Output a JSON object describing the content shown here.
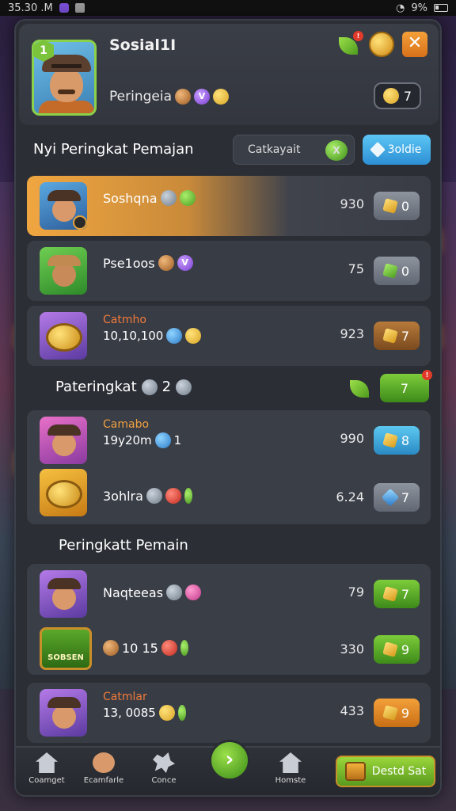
{
  "status_bar": {
    "time": "35.30 .M",
    "battery": "9%"
  },
  "profile": {
    "level": "1",
    "name": "Sosial1I",
    "subtitle": "Peringeia",
    "currency_value": "7"
  },
  "ranking": {
    "header": "Nyi Peringkat Pemajan",
    "category_label": "Catkayait",
    "category_icon_text": "X",
    "sort_label": "3oldie"
  },
  "rows_top": [
    {
      "name": "Soshqna",
      "score": "930",
      "btn_value": "0",
      "style": "highlight"
    },
    {
      "name": "Pse1oos",
      "score": "75",
      "btn_value": "0",
      "style": "normal"
    },
    {
      "title": "Catmho",
      "name": "10,10,100",
      "score": "923",
      "btn_value": "7",
      "style": "normal"
    }
  ],
  "section2": {
    "label": "Pateringkat",
    "count": "2",
    "btn_value": "7"
  },
  "rows_group": [
    {
      "title": "Camabo",
      "name": "19y20m",
      "extra": "1",
      "score": "990",
      "btn_value": "8"
    },
    {
      "name": "3ohlra",
      "score": "6.24",
      "btn_value": "7"
    }
  ],
  "section3": {
    "label": "Peringkatt Pemain"
  },
  "rows_group2": [
    {
      "name": "Naqteeas",
      "score": "79",
      "btn_value": "7"
    },
    {
      "badge_text": "SOBSEN",
      "name": "10 15",
      "score": "330",
      "btn_value": "9"
    }
  ],
  "rows_last": [
    {
      "title": "Catmlar",
      "name": "13, 0085",
      "score": "433",
      "btn_value": "9"
    }
  ],
  "bottom_nav": {
    "items": [
      "Coamget",
      "Ecamfarle",
      "Conce",
      "Homste"
    ],
    "cta_label": "Destd Sat"
  }
}
